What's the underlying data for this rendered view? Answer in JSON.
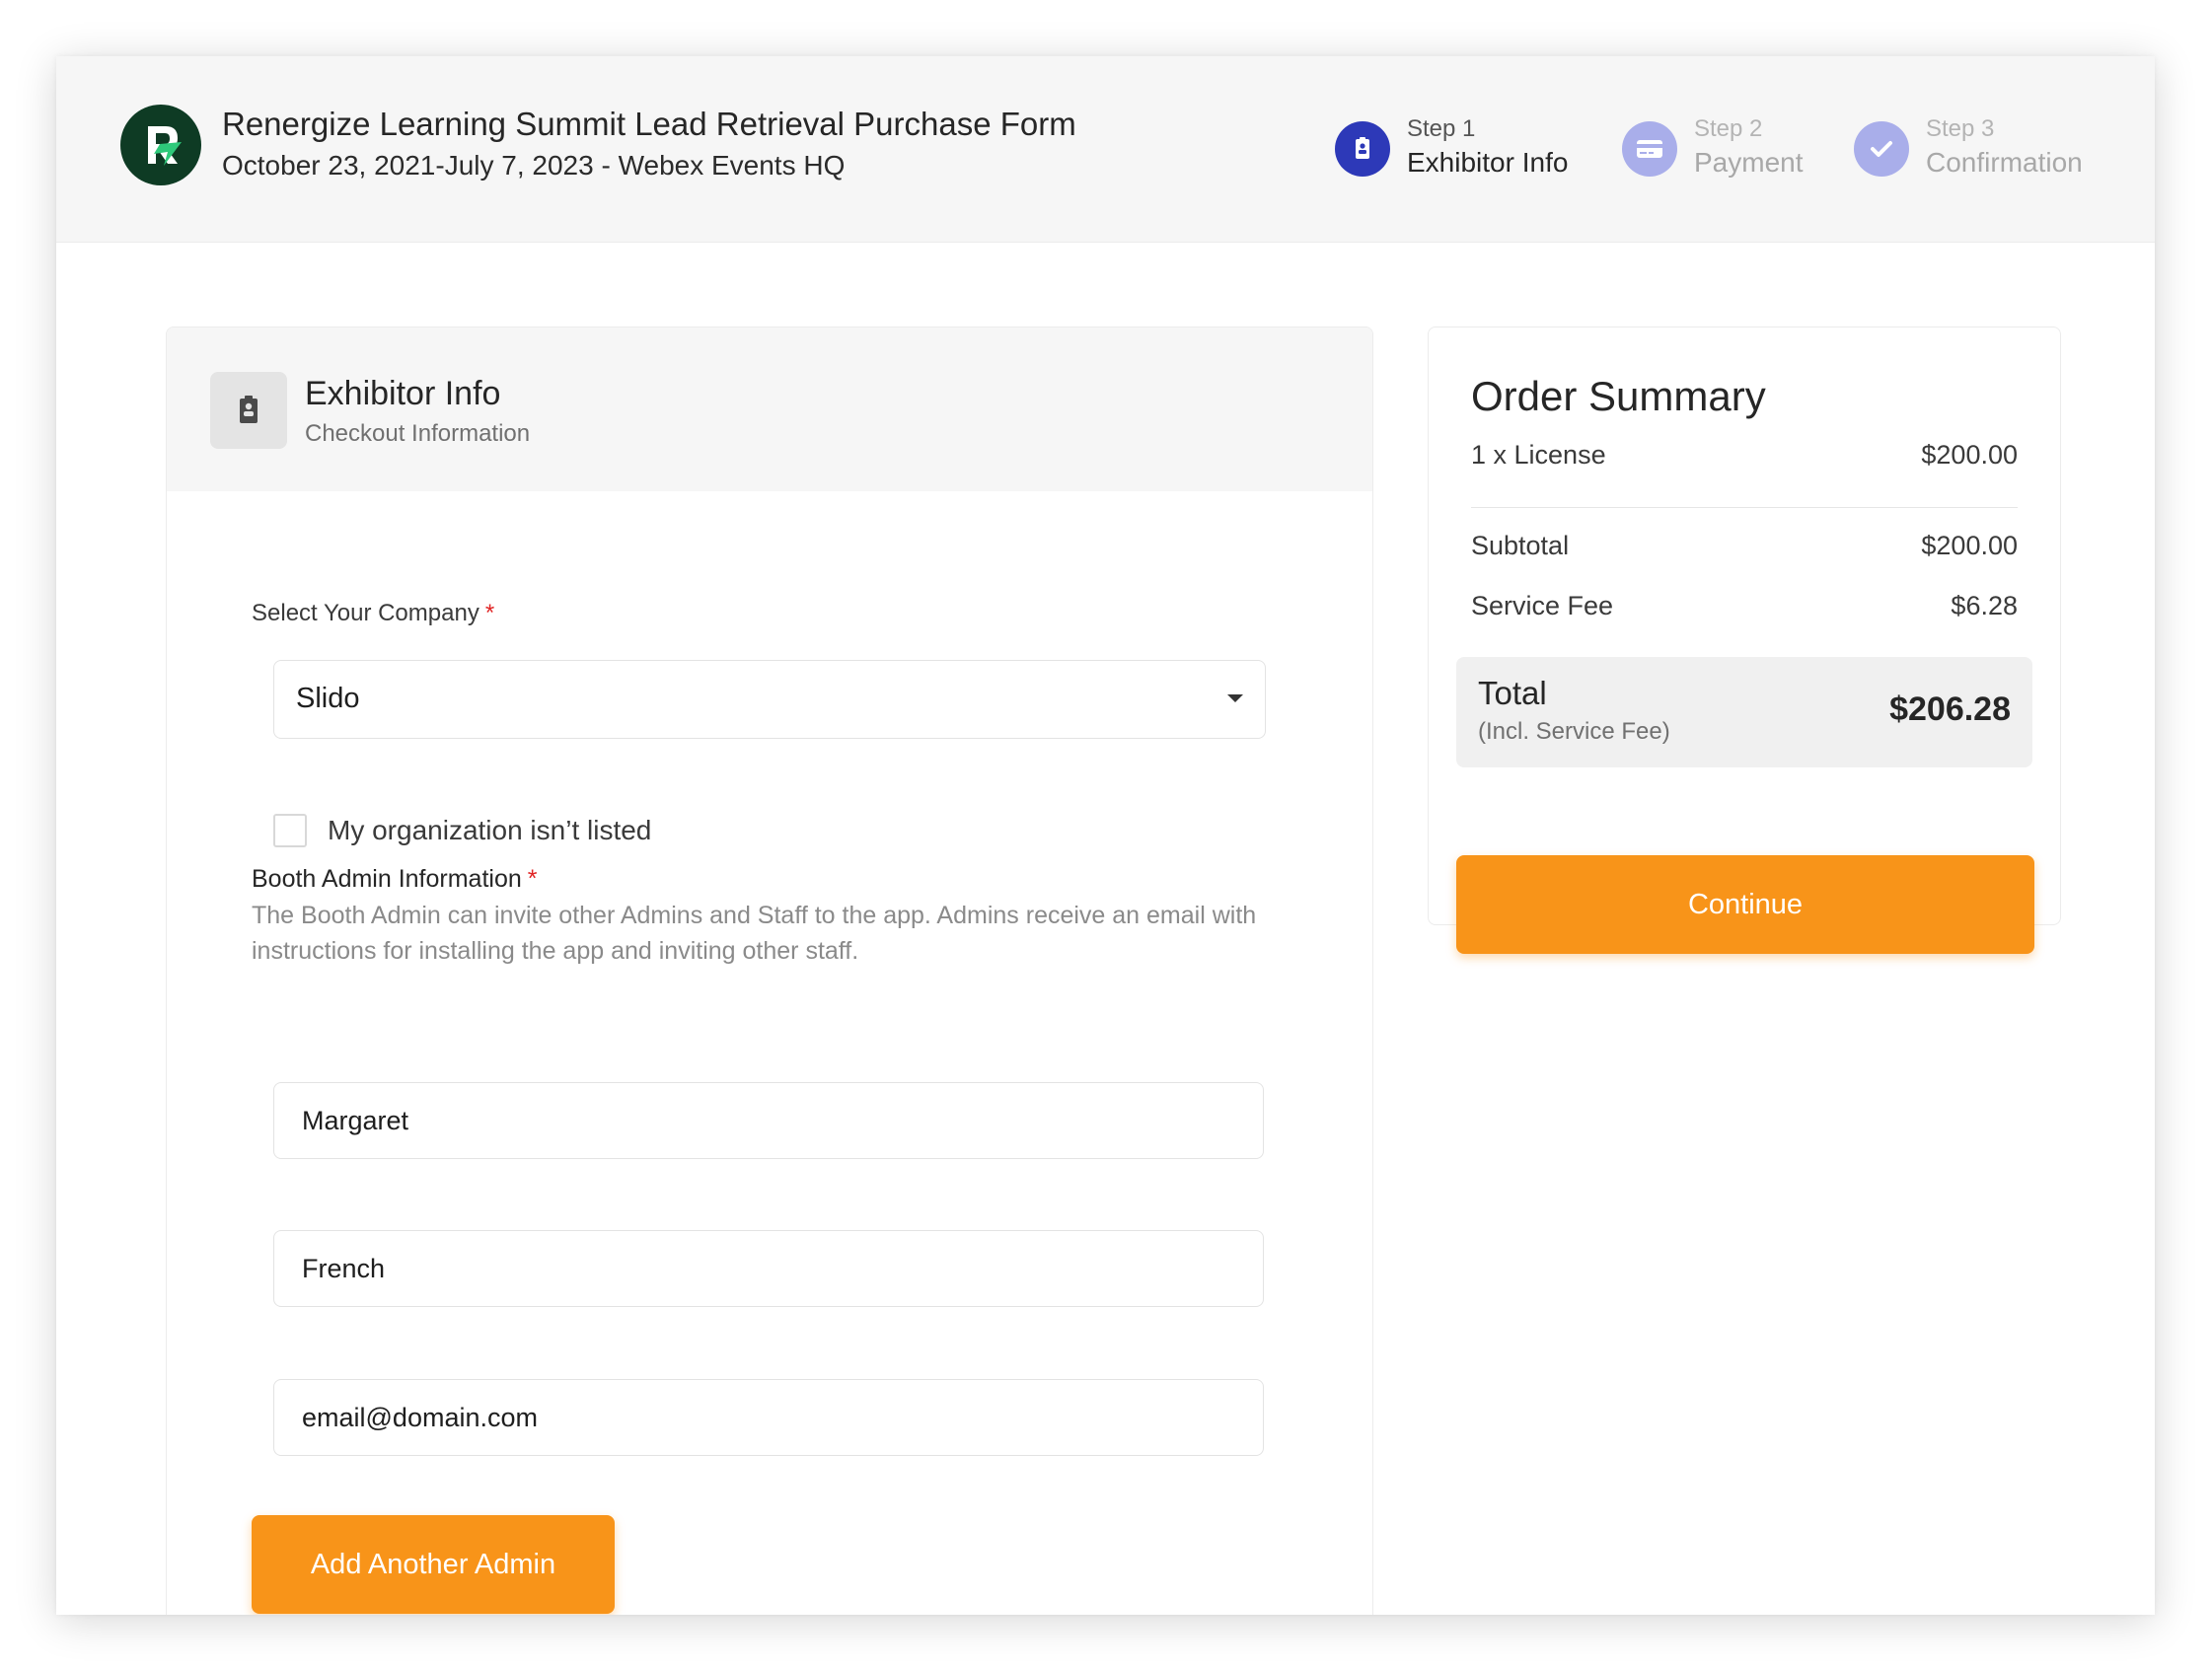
{
  "header": {
    "title": "Renergize Learning Summit Lead Retrieval Purchase Form",
    "subtitle": "October 23, 2021-July 7, 2023 - Webex Events HQ",
    "logo_icon": "renergize-logo",
    "steps": [
      {
        "number": "Step 1",
        "label": "Exhibitor Info",
        "icon": "id-badge-icon",
        "state": "active"
      },
      {
        "number": "Step 2",
        "label": "Payment",
        "icon": "credit-card-icon",
        "state": "inactive"
      },
      {
        "number": "Step 3",
        "label": "Confirmation",
        "icon": "check-icon",
        "state": "inactive"
      }
    ]
  },
  "form": {
    "title": "Exhibitor Info",
    "subtitle": "Checkout Information",
    "company_label": "Select Your Company",
    "required_mark": "*",
    "company_selected": "Slido",
    "not_listed_label": "My organization isn’t listed",
    "not_listed_checked": false,
    "admin_label": "Booth Admin Information",
    "admin_helper": "The Booth Admin can invite other Admins and Staff to the app. Admins receive an email with instructions for installing the app and inviting other staff.",
    "first_name_value": "Margaret",
    "last_name_value": "French",
    "email_value": "email@domain.com",
    "add_admin_label": "Add Another Admin"
  },
  "summary": {
    "title": "Order Summary",
    "line_item_label": "1 x License",
    "line_item_value": "$200.00",
    "subtotal_label": "Subtotal",
    "subtotal_value": "$200.00",
    "service_fee_label": "Service Fee",
    "service_fee_value": "$6.28",
    "total_label": "Total",
    "total_sub": "(Incl. Service Fee)",
    "total_value": "$206.28",
    "continue_label": "Continue"
  },
  "colors": {
    "accent_orange": "#f89419",
    "step_active": "#2d39b8",
    "step_inactive": "#a9aeea",
    "logo_bg": "#0e3b24",
    "required": "#e02424"
  }
}
